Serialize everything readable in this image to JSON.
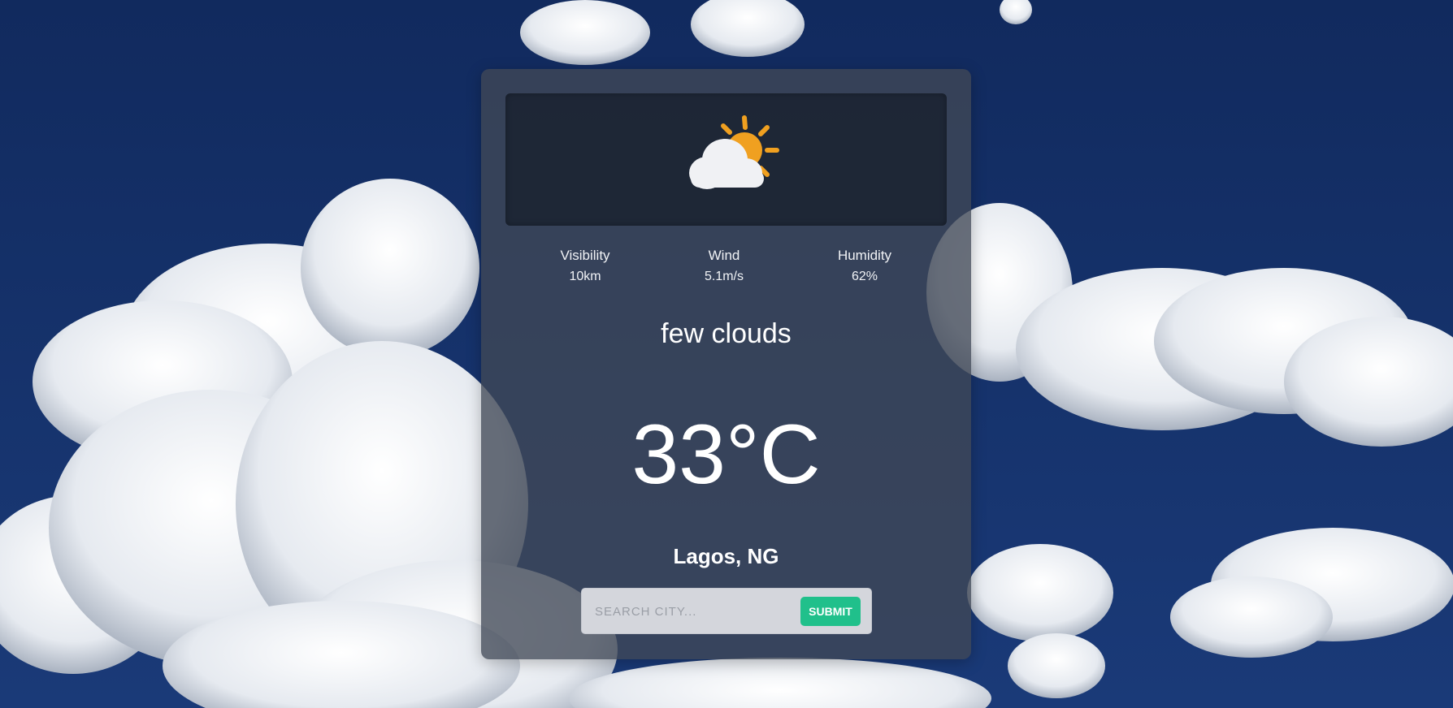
{
  "background": {
    "sky_color": "#14306a",
    "cloud_color": "#f4f6fa"
  },
  "weather": {
    "icon": "partly-cloudy-day-icon",
    "description": "few clouds",
    "temperature": "33°C",
    "location": "Lagos, NG"
  },
  "stats": {
    "visibility": {
      "label": "Visibility",
      "value": "10km"
    },
    "wind": {
      "label": "Wind",
      "value": "5.1m/s"
    },
    "humidity": {
      "label": "Humidity",
      "value": "62%"
    }
  },
  "search": {
    "placeholder": "SEARCH CITY...",
    "value": "",
    "submit_label": "SUBMIT",
    "submit_color": "#20c08b"
  }
}
